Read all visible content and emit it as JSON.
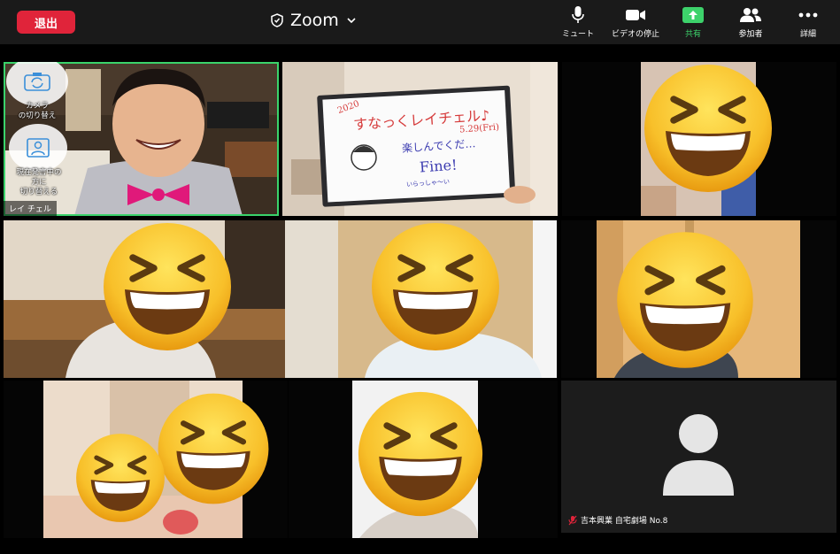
{
  "toolbar": {
    "leave_label": "退出",
    "title": "Zoom",
    "buttons": [
      {
        "label": "ミュート",
        "icon": "microphone-icon"
      },
      {
        "label": "ビデオの停止",
        "icon": "video-camera-icon"
      },
      {
        "label": "共有",
        "icon": "share-screen-icon"
      },
      {
        "label": "参加者",
        "icon": "participants-icon"
      },
      {
        "label": "詳細",
        "icon": "more-icon"
      }
    ]
  },
  "self_view": {
    "camera_switch_label": "カメラ\nの切り替え",
    "speaker_switch_label": "現在発言中の\n方に\n切り替える",
    "name": "レイ チェル"
  },
  "whiteboard": {
    "year": "2020",
    "title": "すなっくレイチェル♪",
    "date": "5.29(Fri)",
    "line1": "楽しんでくだ…",
    "line2": "Fine!",
    "line3": "いらっしゃ〜い"
  },
  "last_participant": {
    "name": "吉本興業 自宅劇場 No.8",
    "icon": "muted-microphone-icon"
  },
  "colors": {
    "leave": "#e0243a",
    "share_green": "#3dd26b",
    "active_border": "#3ad36b"
  }
}
